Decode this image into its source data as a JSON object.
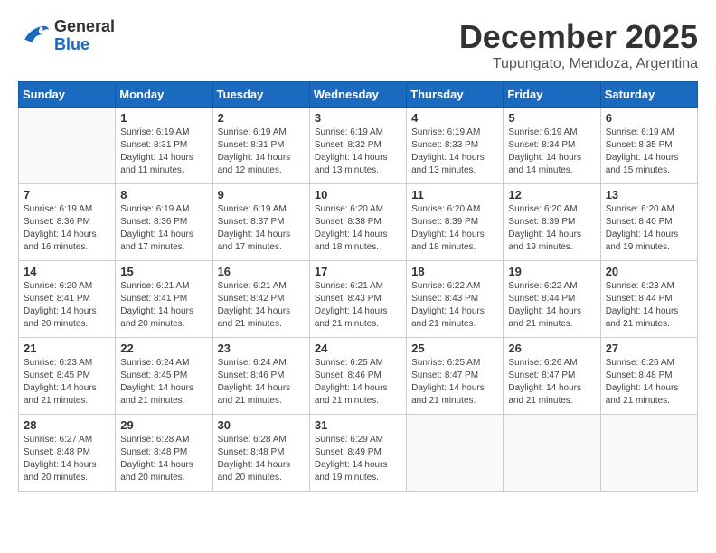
{
  "header": {
    "logo_general": "General",
    "logo_blue": "Blue",
    "month_title": "December 2025",
    "location": "Tupungato, Mendoza, Argentina"
  },
  "calendar": {
    "days_of_week": [
      "Sunday",
      "Monday",
      "Tuesday",
      "Wednesday",
      "Thursday",
      "Friday",
      "Saturday"
    ],
    "weeks": [
      [
        {
          "day": "",
          "info": ""
        },
        {
          "day": "1",
          "info": "Sunrise: 6:19 AM\nSunset: 8:31 PM\nDaylight: 14 hours\nand 11 minutes."
        },
        {
          "day": "2",
          "info": "Sunrise: 6:19 AM\nSunset: 8:31 PM\nDaylight: 14 hours\nand 12 minutes."
        },
        {
          "day": "3",
          "info": "Sunrise: 6:19 AM\nSunset: 8:32 PM\nDaylight: 14 hours\nand 13 minutes."
        },
        {
          "day": "4",
          "info": "Sunrise: 6:19 AM\nSunset: 8:33 PM\nDaylight: 14 hours\nand 13 minutes."
        },
        {
          "day": "5",
          "info": "Sunrise: 6:19 AM\nSunset: 8:34 PM\nDaylight: 14 hours\nand 14 minutes."
        },
        {
          "day": "6",
          "info": "Sunrise: 6:19 AM\nSunset: 8:35 PM\nDaylight: 14 hours\nand 15 minutes."
        }
      ],
      [
        {
          "day": "7",
          "info": "Sunrise: 6:19 AM\nSunset: 8:36 PM\nDaylight: 14 hours\nand 16 minutes."
        },
        {
          "day": "8",
          "info": "Sunrise: 6:19 AM\nSunset: 8:36 PM\nDaylight: 14 hours\nand 17 minutes."
        },
        {
          "day": "9",
          "info": "Sunrise: 6:19 AM\nSunset: 8:37 PM\nDaylight: 14 hours\nand 17 minutes."
        },
        {
          "day": "10",
          "info": "Sunrise: 6:20 AM\nSunset: 8:38 PM\nDaylight: 14 hours\nand 18 minutes."
        },
        {
          "day": "11",
          "info": "Sunrise: 6:20 AM\nSunset: 8:39 PM\nDaylight: 14 hours\nand 18 minutes."
        },
        {
          "day": "12",
          "info": "Sunrise: 6:20 AM\nSunset: 8:39 PM\nDaylight: 14 hours\nand 19 minutes."
        },
        {
          "day": "13",
          "info": "Sunrise: 6:20 AM\nSunset: 8:40 PM\nDaylight: 14 hours\nand 19 minutes."
        }
      ],
      [
        {
          "day": "14",
          "info": "Sunrise: 6:20 AM\nSunset: 8:41 PM\nDaylight: 14 hours\nand 20 minutes."
        },
        {
          "day": "15",
          "info": "Sunrise: 6:21 AM\nSunset: 8:41 PM\nDaylight: 14 hours\nand 20 minutes."
        },
        {
          "day": "16",
          "info": "Sunrise: 6:21 AM\nSunset: 8:42 PM\nDaylight: 14 hours\nand 21 minutes."
        },
        {
          "day": "17",
          "info": "Sunrise: 6:21 AM\nSunset: 8:43 PM\nDaylight: 14 hours\nand 21 minutes."
        },
        {
          "day": "18",
          "info": "Sunrise: 6:22 AM\nSunset: 8:43 PM\nDaylight: 14 hours\nand 21 minutes."
        },
        {
          "day": "19",
          "info": "Sunrise: 6:22 AM\nSunset: 8:44 PM\nDaylight: 14 hours\nand 21 minutes."
        },
        {
          "day": "20",
          "info": "Sunrise: 6:23 AM\nSunset: 8:44 PM\nDaylight: 14 hours\nand 21 minutes."
        }
      ],
      [
        {
          "day": "21",
          "info": "Sunrise: 6:23 AM\nSunset: 8:45 PM\nDaylight: 14 hours\nand 21 minutes."
        },
        {
          "day": "22",
          "info": "Sunrise: 6:24 AM\nSunset: 8:45 PM\nDaylight: 14 hours\nand 21 minutes."
        },
        {
          "day": "23",
          "info": "Sunrise: 6:24 AM\nSunset: 8:46 PM\nDaylight: 14 hours\nand 21 minutes."
        },
        {
          "day": "24",
          "info": "Sunrise: 6:25 AM\nSunset: 8:46 PM\nDaylight: 14 hours\nand 21 minutes."
        },
        {
          "day": "25",
          "info": "Sunrise: 6:25 AM\nSunset: 8:47 PM\nDaylight: 14 hours\nand 21 minutes."
        },
        {
          "day": "26",
          "info": "Sunrise: 6:26 AM\nSunset: 8:47 PM\nDaylight: 14 hours\nand 21 minutes."
        },
        {
          "day": "27",
          "info": "Sunrise: 6:26 AM\nSunset: 8:48 PM\nDaylight: 14 hours\nand 21 minutes."
        }
      ],
      [
        {
          "day": "28",
          "info": "Sunrise: 6:27 AM\nSunset: 8:48 PM\nDaylight: 14 hours\nand 20 minutes."
        },
        {
          "day": "29",
          "info": "Sunrise: 6:28 AM\nSunset: 8:48 PM\nDaylight: 14 hours\nand 20 minutes."
        },
        {
          "day": "30",
          "info": "Sunrise: 6:28 AM\nSunset: 8:48 PM\nDaylight: 14 hours\nand 20 minutes."
        },
        {
          "day": "31",
          "info": "Sunrise: 6:29 AM\nSunset: 8:49 PM\nDaylight: 14 hours\nand 19 minutes."
        },
        {
          "day": "",
          "info": ""
        },
        {
          "day": "",
          "info": ""
        },
        {
          "day": "",
          "info": ""
        }
      ]
    ]
  }
}
